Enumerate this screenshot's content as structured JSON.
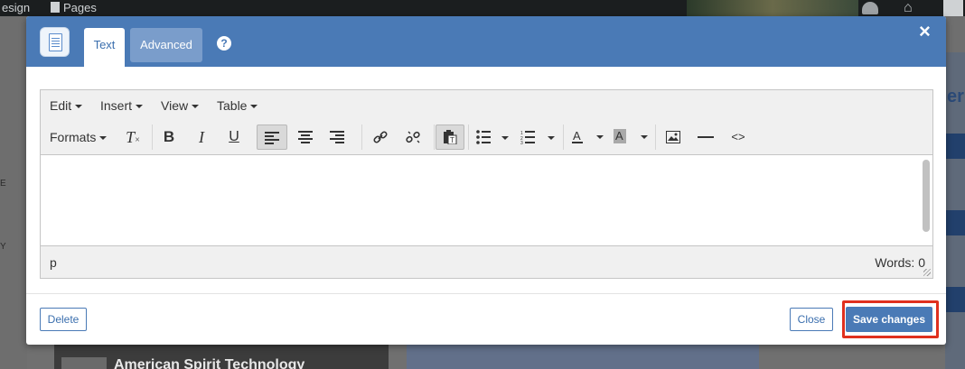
{
  "background": {
    "topbar_left_text": "esign",
    "topbar_pages_text": "Pages",
    "left_letter_1": "E",
    "left_letter_2": "Y",
    "bottom_card_title": "American Spirit Technology"
  },
  "modal": {
    "tabs": [
      {
        "label": "Text",
        "active": true
      },
      {
        "label": "Advanced",
        "active": false
      }
    ],
    "help_label": "?",
    "close_label": "×",
    "accent_color": "#4a7ab6"
  },
  "editor": {
    "menus": [
      "Edit",
      "Insert",
      "View",
      "Table"
    ],
    "formats_label": "Formats",
    "status_path": "p",
    "word_count": "Words: 0"
  },
  "footer": {
    "delete_label": "Delete",
    "close_label": "Close",
    "save_label": "Save changes"
  }
}
